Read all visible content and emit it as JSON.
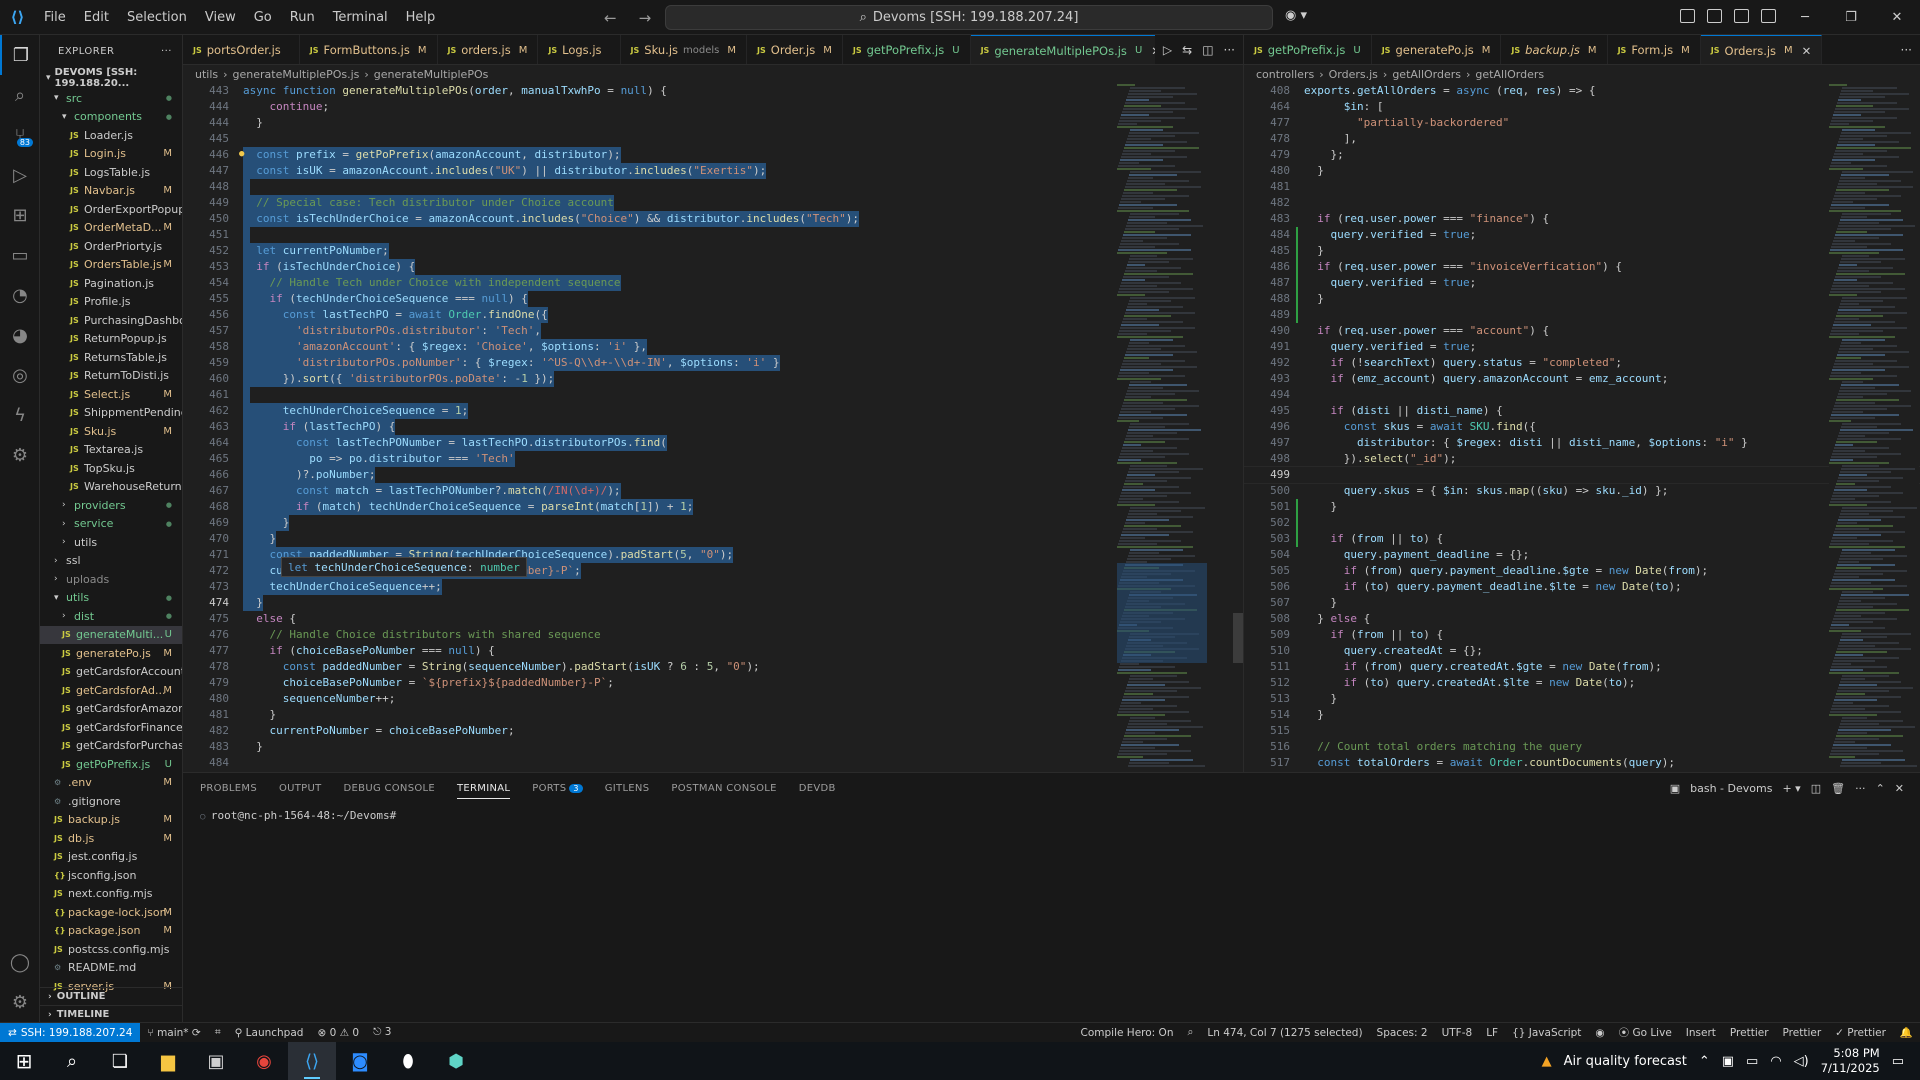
{
  "title_bar": {
    "menu": [
      "File",
      "Edit",
      "Selection",
      "View",
      "Go",
      "Run",
      "Terminal",
      "Help"
    ],
    "search": "Devoms [SSH: 199.188.207.24]"
  },
  "explorer": {
    "header": "EXPLORER",
    "root": "DEVOMS [SSH: 199.188.20...",
    "items": [
      {
        "label": "src",
        "type": "folder",
        "indent": 1,
        "open": true,
        "status": "dot",
        "cls": "folder-g"
      },
      {
        "label": "components",
        "type": "folder",
        "indent": 2,
        "open": true,
        "status": "dot",
        "cls": "folder-g"
      },
      {
        "label": "Loader.js",
        "type": "js",
        "indent": 3,
        "status": "",
        "cls": ""
      },
      {
        "label": "Login.js",
        "type": "js",
        "indent": 3,
        "status": "M",
        "cls": "mod"
      },
      {
        "label": "LogsTable.js",
        "type": "js",
        "indent": 3,
        "status": "",
        "cls": ""
      },
      {
        "label": "Navbar.js",
        "type": "js",
        "indent": 3,
        "status": "M",
        "cls": "mod"
      },
      {
        "label": "OrderExportPopup.js",
        "type": "js",
        "indent": 3,
        "status": "",
        "cls": ""
      },
      {
        "label": "OrderMetaD...",
        "type": "js",
        "indent": 3,
        "status": "M",
        "cls": "mod"
      },
      {
        "label": "OrderPriorty.js",
        "type": "js",
        "indent": 3,
        "status": "",
        "cls": ""
      },
      {
        "label": "OrdersTable.js",
        "type": "js",
        "indent": 3,
        "status": "M",
        "cls": "mod"
      },
      {
        "label": "Pagination.js",
        "type": "js",
        "indent": 3,
        "status": "",
        "cls": ""
      },
      {
        "label": "Profile.js",
        "type": "js",
        "indent": 3,
        "status": "",
        "cls": ""
      },
      {
        "label": "PurchasingDashbo...",
        "type": "js",
        "indent": 3,
        "status": "",
        "cls": ""
      },
      {
        "label": "ReturnPopup.js",
        "type": "js",
        "indent": 3,
        "status": "",
        "cls": ""
      },
      {
        "label": "ReturnsTable.js",
        "type": "js",
        "indent": 3,
        "status": "",
        "cls": ""
      },
      {
        "label": "ReturnToDisti.js",
        "type": "js",
        "indent": 3,
        "status": "",
        "cls": ""
      },
      {
        "label": "Select.js",
        "type": "js",
        "indent": 3,
        "status": "M",
        "cls": "mod"
      },
      {
        "label": "ShippmentPending...",
        "type": "js",
        "indent": 3,
        "status": "",
        "cls": ""
      },
      {
        "label": "Sku.js",
        "type": "js",
        "indent": 3,
        "status": "M",
        "cls": "mod"
      },
      {
        "label": "Textarea.js",
        "type": "js",
        "indent": 3,
        "status": "",
        "cls": ""
      },
      {
        "label": "TopSku.js",
        "type": "js",
        "indent": 3,
        "status": "",
        "cls": ""
      },
      {
        "label": "WarehouseReturn.js",
        "type": "js",
        "indent": 3,
        "status": "",
        "cls": ""
      },
      {
        "label": "providers",
        "type": "folder",
        "indent": 2,
        "open": false,
        "status": "dot",
        "cls": "folder-g"
      },
      {
        "label": "service",
        "type": "folder",
        "indent": 2,
        "open": false,
        "status": "dot",
        "cls": "folder-g"
      },
      {
        "label": "utils",
        "type": "folder",
        "indent": 2,
        "open": false,
        "status": "",
        "cls": ""
      },
      {
        "label": "ssl",
        "type": "folder",
        "indent": 1,
        "open": false,
        "status": "",
        "cls": ""
      },
      {
        "label": "uploads",
        "type": "folder",
        "indent": 1,
        "open": false,
        "status": "",
        "cls": "dim"
      },
      {
        "label": "utils",
        "type": "folder",
        "indent": 1,
        "open": true,
        "status": "dot",
        "cls": "folder-g"
      },
      {
        "label": "dist",
        "type": "folder",
        "indent": 2,
        "open": false,
        "status": "dot",
        "cls": "folder-g"
      },
      {
        "label": "generateMulti...",
        "type": "js",
        "indent": 2,
        "status": "U",
        "cls": "untr sel"
      },
      {
        "label": "generatePo.js",
        "type": "js",
        "indent": 2,
        "status": "M",
        "cls": "mod"
      },
      {
        "label": "getCardsforAccount.js",
        "type": "js",
        "indent": 2,
        "status": "",
        "cls": ""
      },
      {
        "label": "getCardsforAd...",
        "type": "js",
        "indent": 2,
        "status": "M",
        "cls": "mod"
      },
      {
        "label": "getCardsforAmazon.js",
        "type": "js",
        "indent": 2,
        "status": "",
        "cls": ""
      },
      {
        "label": "getCardsforFinance.js",
        "type": "js",
        "indent": 2,
        "status": "",
        "cls": ""
      },
      {
        "label": "getCardsforPurchasi...",
        "type": "js",
        "indent": 2,
        "status": "",
        "cls": ""
      },
      {
        "label": "getPoPrefix.js",
        "type": "js",
        "indent": 2,
        "status": "U",
        "cls": "untr"
      },
      {
        "label": ".env",
        "type": "cfg",
        "indent": 1,
        "status": "M",
        "cls": "mod"
      },
      {
        "label": ".gitignore",
        "type": "cfg",
        "indent": 1,
        "status": "",
        "cls": ""
      },
      {
        "label": "backup.js",
        "type": "js",
        "indent": 1,
        "status": "M",
        "cls": "mod"
      },
      {
        "label": "db.js",
        "type": "js",
        "indent": 1,
        "status": "M",
        "cls": "mod"
      },
      {
        "label": "jest.config.js",
        "type": "js",
        "indent": 1,
        "status": "",
        "cls": ""
      },
      {
        "label": "jsconfig.json",
        "type": "json",
        "indent": 1,
        "status": "",
        "cls": ""
      },
      {
        "label": "next.config.mjs",
        "type": "js",
        "indent": 1,
        "status": "",
        "cls": ""
      },
      {
        "label": "package-lock.json",
        "type": "json",
        "indent": 1,
        "status": "M",
        "cls": "mod"
      },
      {
        "label": "package.json",
        "type": "json",
        "indent": 1,
        "status": "M",
        "cls": "mod"
      },
      {
        "label": "postcss.config.mjs",
        "type": "js",
        "indent": 1,
        "status": "",
        "cls": ""
      },
      {
        "label": "README.md",
        "type": "cfg",
        "indent": 1,
        "status": "",
        "cls": ""
      },
      {
        "label": "server.js",
        "type": "js",
        "indent": 1,
        "status": "M",
        "cls": "mod"
      }
    ],
    "outline": "OUTLINE",
    "timeline": "TIMELINE"
  },
  "left_editor": {
    "tabs": [
      {
        "label": "portsOrder.js",
        "status": "",
        "cls": ""
      },
      {
        "label": "FormButtons.js",
        "status": "M",
        "cls": ""
      },
      {
        "label": "orders.js",
        "status": "M",
        "cls": ""
      },
      {
        "label": "Logs.js",
        "status": "",
        "cls": ""
      },
      {
        "label": "Sku.js",
        "sub": "models",
        "status": "M",
        "cls": ""
      },
      {
        "label": "Order.js",
        "status": "M",
        "cls": ""
      },
      {
        "label": "getPoPrefix.js",
        "status": "U",
        "cls": "untr"
      },
      {
        "label": "generateMultiplePOs.js",
        "status": "U",
        "cls": "active"
      }
    ],
    "breadcrumb": [
      "utils",
      "generateMultiplePOs.js",
      "generateMultiplePOs"
    ],
    "lines": [
      {
        "n": "443",
        "t": "async function generateMultiplePOs(order, manualTxwhPo = null) {"
      },
      {
        "n": "444",
        "t": "    continue;"
      },
      {
        "n": "444",
        "t": "  }"
      },
      {
        "n": "445",
        "t": ""
      },
      {
        "n": "446",
        "t": "  const prefix = getPoPrefix(amazonAccount, distributor);",
        "s": 1
      },
      {
        "n": "447",
        "t": "  const isUK = amazonAccount.includes(\"UK\") || distributor.includes(\"Exertis\");",
        "s": 1
      },
      {
        "n": "448",
        "t": "",
        "s": 1
      },
      {
        "n": "449",
        "t": "  // Special case: Tech distributor under Choice account",
        "s": 1
      },
      {
        "n": "450",
        "t": "  const isTechUnderChoice = amazonAccount.includes(\"Choice\") && distributor.includes(\"Tech\");",
        "s": 1
      },
      {
        "n": "451",
        "t": "",
        "s": 1
      },
      {
        "n": "452",
        "t": "  let currentPoNumber;",
        "s": 1
      },
      {
        "n": "453",
        "t": "  if (isTechUnderChoice) {",
        "s": 1
      },
      {
        "n": "454",
        "t": "    // Handle Tech under Choice with independent sequence",
        "s": 1
      },
      {
        "n": "455",
        "t": "    if (techUnderChoiceSequence === null) {",
        "s": 1
      },
      {
        "n": "456",
        "t": "      const lastTechPO = await Order.findOne({",
        "s": 1
      },
      {
        "n": "457",
        "t": "        'distributorPOs.distributor': 'Tech',",
        "s": 1
      },
      {
        "n": "458",
        "t": "        'amazonAccount': { $regex: 'Choice', $options: 'i' },",
        "s": 1
      },
      {
        "n": "459",
        "t": "        'distributorPOs.poNumber': { $regex: '^US-Q\\\\d+-\\\\d+-IN', $options: 'i' }",
        "s": 1
      },
      {
        "n": "460",
        "t": "      }).sort({ 'distributorPOs.poDate': -1 });",
        "s": 1
      },
      {
        "n": "461",
        "t": "",
        "s": 1
      },
      {
        "n": "462",
        "t": "      techUnderChoiceSequence = 1;",
        "s": 1
      },
      {
        "n": "463",
        "t": "      if (lastTechPO) {",
        "s": 1
      },
      {
        "n": "464",
        "t": "        const lastTechPONumber = lastTechPO.distributorPOs.find(",
        "s": 1
      },
      {
        "n": "465",
        "t": "          po => po.distributor === 'Tech'",
        "s": 1
      },
      {
        "n": "466",
        "t": "        )?.poNumber;",
        "s": 1
      },
      {
        "n": "467",
        "t": "        const match = lastTechPONumber?.match(/IN(\\d+)/);",
        "s": 1
      },
      {
        "n": "468",
        "t": "        if (match) techUnderChoiceSequence = parseInt(match[1]) + 1;",
        "s": 1
      },
      {
        "n": "469",
        "t": "      }",
        "s": 1
      },
      {
        "n": "470",
        "t": "    }",
        "s": 1
      },
      {
        "n": "471",
        "t": "    const paddedNumber = String(techUnderChoiceSequence).padStart(5, \"0\");",
        "s": 1
      },
      {
        "n": "472",
        "t": "    currentPoNumber = `${prefix}${paddedNumber}-P`;",
        "s": 1
      },
      {
        "n": "473",
        "t": "    techUnderChoiceSequence++;",
        "s": 1
      },
      {
        "n": "474",
        "t": "  }",
        "s": 1,
        "cur": 1
      },
      {
        "n": "475",
        "t": "  else {"
      },
      {
        "n": "476",
        "t": "    // Handle Choice distributors with shared sequence"
      },
      {
        "n": "477",
        "t": "    if (choiceBasePoNumber === null) {"
      },
      {
        "n": "478",
        "t": "      const paddedNumber = String(sequenceNumber).padStart(isUK ? 6 : 5, \"0\");"
      },
      {
        "n": "479",
        "t": "      choiceBasePoNumber = `${prefix}${paddedNumber}-P`;"
      },
      {
        "n": "480",
        "t": "      sequenceNumber++;"
      },
      {
        "n": "481",
        "t": "    }"
      },
      {
        "n": "482",
        "t": "    currentPoNumber = choiceBasePoNumber;"
      },
      {
        "n": "483",
        "t": "  }"
      },
      {
        "n": "484",
        "t": ""
      }
    ],
    "tooltip": "let techUnderChoiceSequence: number"
  },
  "right_editor": {
    "tabs": [
      {
        "label": "getPoPrefix.js",
        "status": "U",
        "cls": "untr"
      },
      {
        "label": "generatePo.js",
        "status": "M",
        "cls": ""
      },
      {
        "label": "backup.js",
        "status": "M",
        "cls": ""
      },
      {
        "label": "Form.js",
        "status": "M",
        "cls": ""
      },
      {
        "label": "Orders.js",
        "status": "M",
        "cls": "active2"
      }
    ],
    "breadcrumb": [
      "controllers",
      "Orders.js",
      "getAllOrders",
      "getAllOrders"
    ],
    "lines": [
      {
        "n": "408",
        "t": "exports.getAllOrders = async (req, res) => {"
      },
      {
        "n": "464",
        "t": "      $in: ["
      },
      {
        "n": "477",
        "t": "        \"partially-backordered\""
      },
      {
        "n": "478",
        "t": "      ],"
      },
      {
        "n": "479",
        "t": "    };"
      },
      {
        "n": "480",
        "t": "  }"
      },
      {
        "n": "481",
        "t": ""
      },
      {
        "n": "482",
        "t": ""
      },
      {
        "n": "483",
        "t": "  if (req.user.power === \"finance\") {"
      },
      {
        "n": "484",
        "t": "    query.verified = true;"
      },
      {
        "n": "485",
        "t": "  }"
      },
      {
        "n": "486",
        "t": "  if (req.user.power === \"invoiceVerfication\") {"
      },
      {
        "n": "487",
        "t": "    query.verified = true;"
      },
      {
        "n": "488",
        "t": "  }"
      },
      {
        "n": "489",
        "t": ""
      },
      {
        "n": "490",
        "t": "  if (req.user.power === \"account\") {"
      },
      {
        "n": "491",
        "t": "    query.verified = true;"
      },
      {
        "n": "492",
        "t": "    if (!searchText) query.status = \"completed\";"
      },
      {
        "n": "493",
        "t": "    if (emz_account) query.amazonAccount = emz_account;"
      },
      {
        "n": "494",
        "t": ""
      },
      {
        "n": "495",
        "t": "    if (disti || disti_name) {"
      },
      {
        "n": "496",
        "t": "      const skus = await SKU.find({"
      },
      {
        "n": "497",
        "t": "        distributor: { $regex: disti || disti_name, $options: \"i\" }"
      },
      {
        "n": "498",
        "t": "      }).select(\"_id\");"
      },
      {
        "n": "499",
        "t": "",
        "cur": 1
      },
      {
        "n": "500",
        "t": "      query.skus = { $in: skus.map((sku) => sku._id) };"
      },
      {
        "n": "501",
        "t": "    }"
      },
      {
        "n": "502",
        "t": ""
      },
      {
        "n": "503",
        "t": "    if (from || to) {"
      },
      {
        "n": "504",
        "t": "      query.payment_deadline = {};"
      },
      {
        "n": "505",
        "t": "      if (from) query.payment_deadline.$gte = new Date(from);"
      },
      {
        "n": "506",
        "t": "      if (to) query.payment_deadline.$lte = new Date(to);"
      },
      {
        "n": "507",
        "t": "    }"
      },
      {
        "n": "508",
        "t": "  } else {"
      },
      {
        "n": "509",
        "t": "    if (from || to) {"
      },
      {
        "n": "510",
        "t": "      query.createdAt = {};"
      },
      {
        "n": "511",
        "t": "      if (from) query.createdAt.$gte = new Date(from);"
      },
      {
        "n": "512",
        "t": "      if (to) query.createdAt.$lte = new Date(to);"
      },
      {
        "n": "513",
        "t": "    }"
      },
      {
        "n": "514",
        "t": "  }"
      },
      {
        "n": "515",
        "t": ""
      },
      {
        "n": "516",
        "t": "  // Count total orders matching the query"
      },
      {
        "n": "517",
        "t": "  const totalOrders = await Order.countDocuments(query);"
      }
    ]
  },
  "panel": {
    "tabs": [
      "PROBLEMS",
      "OUTPUT",
      "DEBUG CONSOLE",
      "TERMINAL",
      "PORTS",
      "GITLENS",
      "POSTMAN CONSOLE",
      "DEVDB"
    ],
    "active": "TERMINAL",
    "ports_count": "3",
    "shell": "bash - Devoms",
    "prompt": "root@nc-ph-1564-48:~/Devoms#"
  },
  "status_bar": {
    "remote": "SSH: 199.188.207.24",
    "branch": "main*",
    "launchpad": "Launchpad",
    "errors": "0",
    "warnings": "0",
    "ports": "3",
    "compile_hero": "Compile Hero: On",
    "cursor": "Ln 474, Col 7 (1275 selected)",
    "spaces": "Spaces: 2",
    "encoding": "UTF-8",
    "eol": "LF",
    "language": "JavaScript",
    "golive": "Go Live",
    "insert": "Insert",
    "prettier1": "Prettier",
    "prettier2": "Prettier",
    "prettier3": "Prettier"
  },
  "taskbar": {
    "weather": "Air quality forecast",
    "time": "5:08 PM",
    "date": "7/11/2025"
  }
}
